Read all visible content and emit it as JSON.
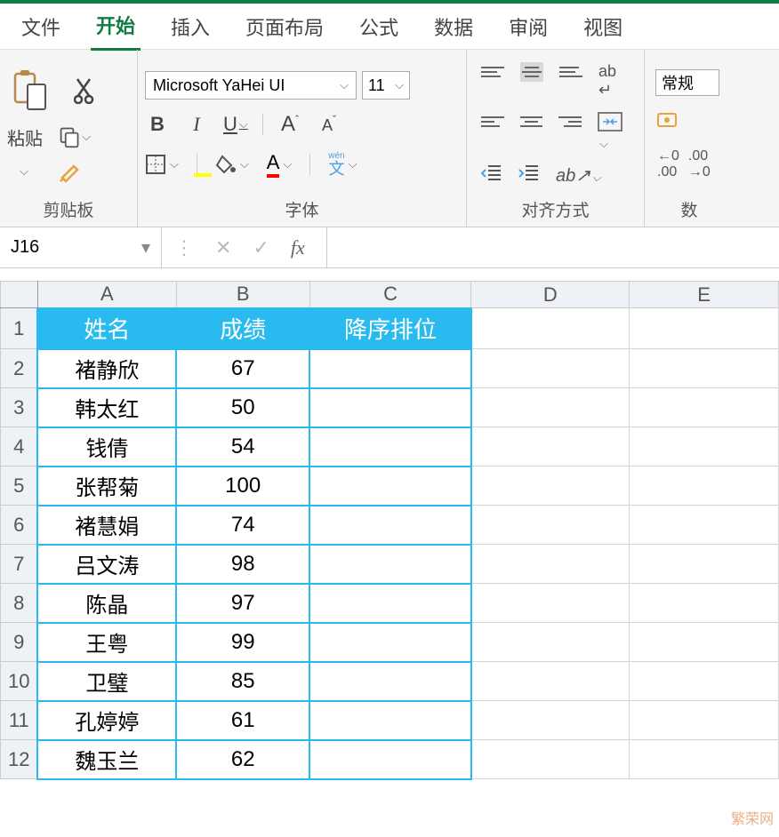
{
  "tabs": {
    "file": "文件",
    "home": "开始",
    "insert": "插入",
    "layout": "页面布局",
    "formulas": "公式",
    "data": "数据",
    "review": "审阅",
    "view": "视图"
  },
  "groups": {
    "clipboard": "剪贴板",
    "font": "字体",
    "alignment": "对齐方式",
    "number": "数"
  },
  "clipboard": {
    "paste": "粘贴"
  },
  "font": {
    "name": "Microsoft YaHei UI",
    "size": "11",
    "bold": "B",
    "italic": "I",
    "underline": "U",
    "inc": "A",
    "dec": "A",
    "wen": "wén",
    "wen_cn": "文",
    "color_letter": "A"
  },
  "number": {
    "format": "常规"
  },
  "namebox": {
    "ref": "J16"
  },
  "fx": {
    "label": "fx"
  },
  "columns": {
    "A": "A",
    "B": "B",
    "C": "C",
    "D": "D",
    "E": "E"
  },
  "rows": [
    "1",
    "2",
    "3",
    "4",
    "5",
    "6",
    "7",
    "8",
    "9",
    "10",
    "11",
    "12"
  ],
  "headers": {
    "name": "姓名",
    "score": "成绩",
    "rank": "降序排位"
  },
  "data": [
    {
      "name": "褚静欣",
      "score": "67"
    },
    {
      "name": "韩太红",
      "score": "50"
    },
    {
      "name": "钱倩",
      "score": "54"
    },
    {
      "name": "张帮菊",
      "score": "100"
    },
    {
      "name": "褚慧娟",
      "score": "74"
    },
    {
      "name": "吕文涛",
      "score": "98"
    },
    {
      "name": "陈晶",
      "score": "97"
    },
    {
      "name": "王粤",
      "score": "99"
    },
    {
      "name": "卫璧",
      "score": "85"
    },
    {
      "name": "孔婷婷",
      "score": "61"
    },
    {
      "name": "魏玉兰",
      "score": "62"
    }
  ],
  "watermark": "繁荣网"
}
